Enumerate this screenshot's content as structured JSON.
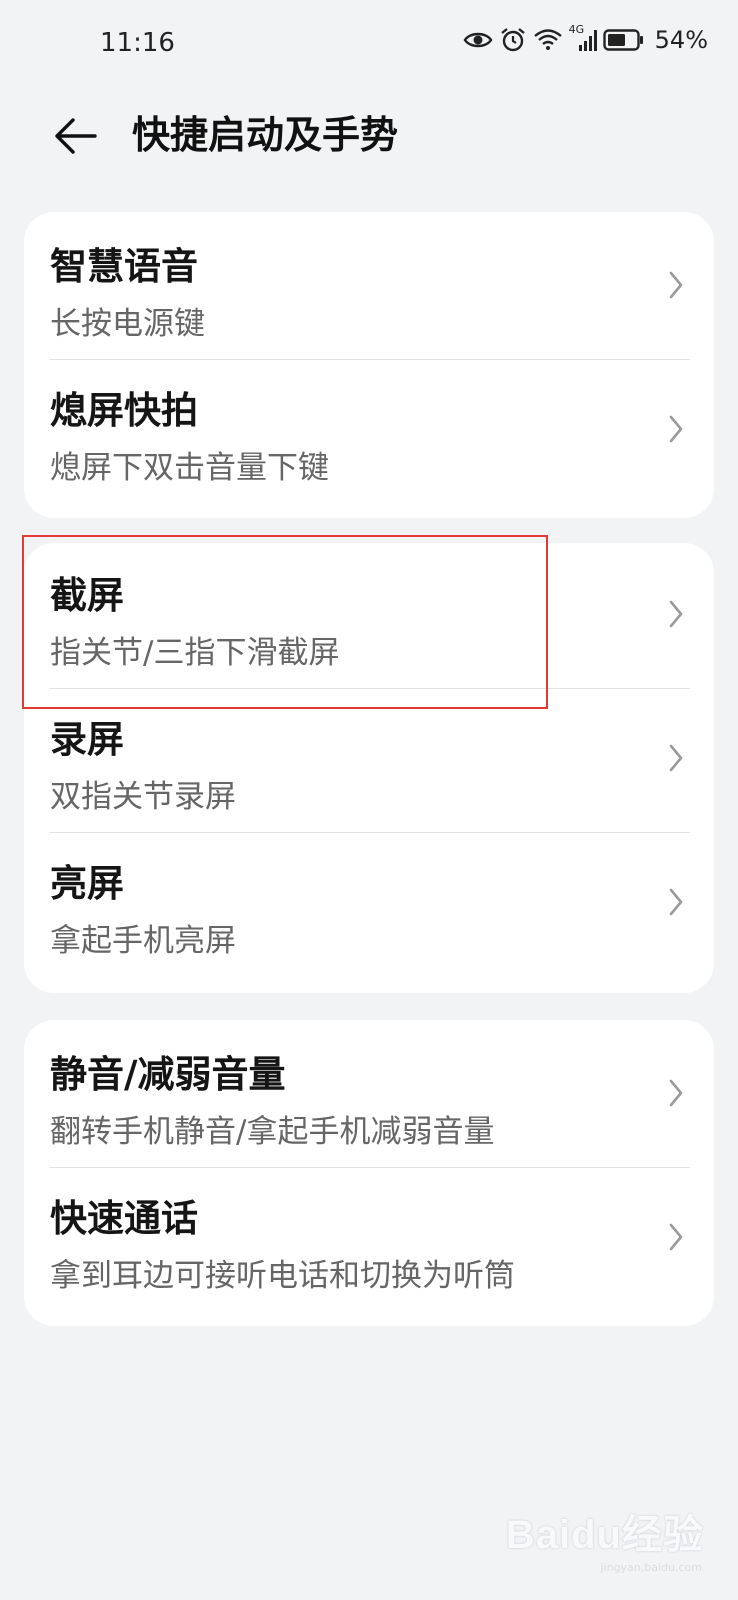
{
  "status_bar": {
    "time": "11:16",
    "network": "4G",
    "battery": "54%",
    "icons": [
      "eye-icon",
      "alarm-icon",
      "wifi-icon",
      "signal-icon",
      "battery-icon"
    ]
  },
  "header": {
    "title": "快捷启动及手势",
    "back_icon": "back-arrow-icon"
  },
  "groups": [
    {
      "items": [
        {
          "label": "智慧语音",
          "sub": "长按电源键"
        },
        {
          "label": "熄屏快拍",
          "sub": "熄屏下双击音量下键"
        }
      ]
    },
    {
      "items": [
        {
          "label": "截屏",
          "sub": "指关节/三指下滑截屏"
        },
        {
          "label": "录屏",
          "sub": "双指关节录屏"
        },
        {
          "label": "亮屏",
          "sub": "拿起手机亮屏"
        }
      ]
    },
    {
      "items": [
        {
          "label": "静音/减弱音量",
          "sub": "翻转手机静音/拿起手机减弱音量"
        },
        {
          "label": "快速通话",
          "sub": "拿到耳边可接听电话和切换为听筒"
        }
      ]
    }
  ],
  "highlight_color": "#e53935",
  "watermark": {
    "text": "Baidu经验",
    "sub": "jingyan.baidu.com"
  }
}
